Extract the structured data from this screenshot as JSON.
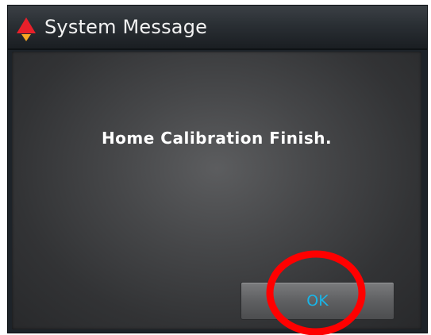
{
  "dialog": {
    "title": "System Message",
    "icon": "warning-triangle-icon",
    "message": "Home Calibration Finish.",
    "ok_label": "OK"
  },
  "colors": {
    "title_bar": "#2a2f34",
    "panel": "#464749",
    "ok_text": "#19b5e8",
    "icon_red": "#e8202a",
    "icon_orange": "#f5a623",
    "annotation_circle": "#ff0000"
  },
  "annotation": {
    "shape": "circle",
    "target": "ok-button"
  }
}
